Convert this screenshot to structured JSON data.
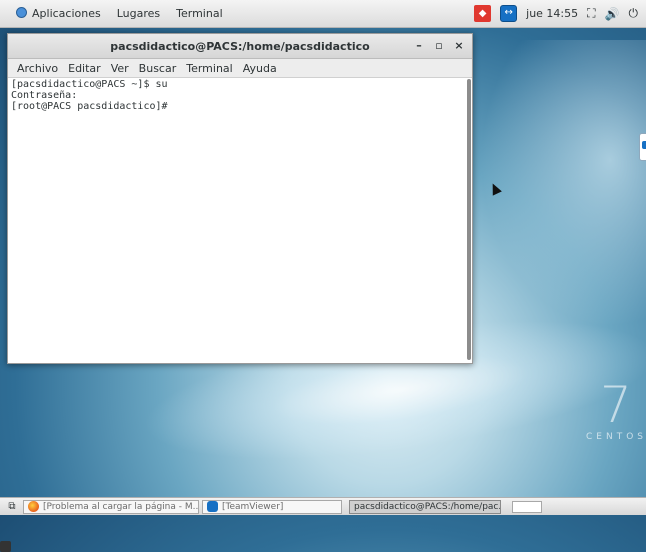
{
  "top_panel": {
    "applications_label": "Aplicaciones",
    "places_label": "Lugares",
    "terminal_label": "Terminal",
    "clock": "jue 14:55"
  },
  "window": {
    "title": "pacsdidactico@PACS:/home/pacsdidactico",
    "minimize_glyph": "–",
    "maximize_glyph": "▫",
    "close_glyph": "×",
    "menu": [
      "Archivo",
      "Editar",
      "Ver",
      "Buscar",
      "Terminal",
      "Ayuda"
    ],
    "lines": [
      "[pacsdidactico@PACS ~]$ su",
      "Contraseña:",
      "[root@PACS pacsdidactico]#"
    ]
  },
  "desktop": {
    "logo_number": "7",
    "logo_word": "CENTOS"
  },
  "taskbar": {
    "tasks": [
      {
        "label": "[Problema al cargar la página - M...",
        "icon": "firefox-icon",
        "active": false
      },
      {
        "label": "[TeamViewer]",
        "icon": "teamviewer-icon",
        "active": false
      },
      {
        "label": "pacsdidactico@PACS:/home/pac...",
        "icon": "terminal-icon",
        "active": true
      }
    ]
  }
}
